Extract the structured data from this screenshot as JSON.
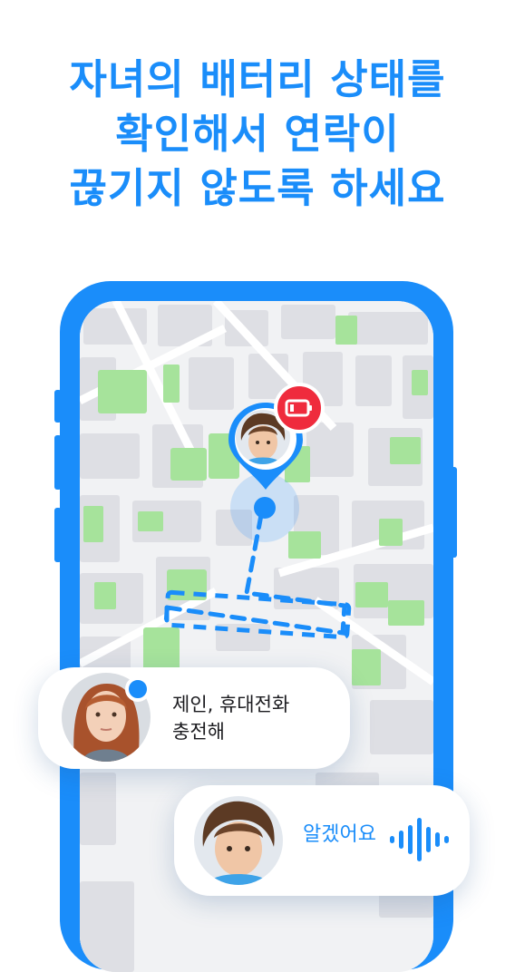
{
  "headline": {
    "line1": "자녀의 배터리 상태를",
    "line2": "확인해서 연락이",
    "line3": "끊기지 않도록 하세요"
  },
  "colors": {
    "brand_blue": "#1a8dfa",
    "map_park_green": "#a6e39b",
    "battery_alert_red": "#ef2b3d",
    "map_block": "#dedfe4"
  },
  "map": {
    "child_pin_icon": "child-avatar-pin",
    "battery_icon": "low-battery-icon"
  },
  "messages": [
    {
      "sender_avatar": "mother-avatar",
      "text_line1": "제인, 휴대전화",
      "text_line2": "충전해"
    },
    {
      "sender_avatar": "child-avatar",
      "text": "알겠어요",
      "voice_icon": "sound-wave-icon"
    }
  ]
}
